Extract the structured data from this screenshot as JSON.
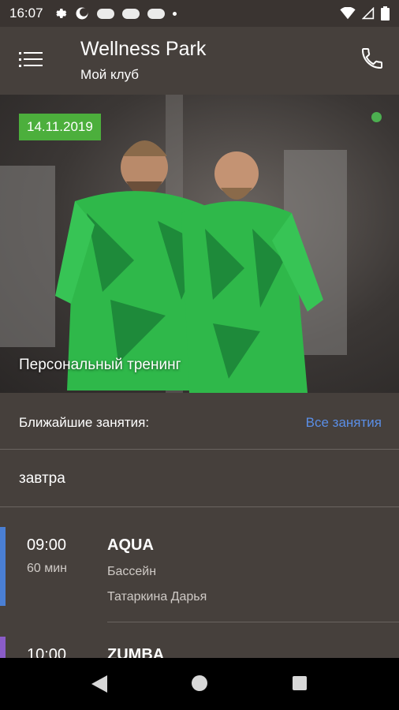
{
  "status_bar": {
    "time": "16:07"
  },
  "app_bar": {
    "title": "Wellness Park",
    "subtitle": "Мой клуб"
  },
  "hero": {
    "date": "14.11.2019",
    "caption": "Персональный тренинг"
  },
  "upcoming": {
    "label": "Ближайшие занятия:",
    "all_link": "Все занятия"
  },
  "day_label": "завтра",
  "classes": [
    {
      "time": "09:00",
      "duration": "60 мин",
      "name": "AQUA",
      "place": "Бассейн",
      "coach": "Татаркина Дарья",
      "color": "#4a7fd4"
    },
    {
      "time": "10:00",
      "duration": "",
      "name": "ZUMBA",
      "place": "",
      "coach": "",
      "color": "#8a5cc8"
    }
  ],
  "colors": {
    "background": "#46403c",
    "accent_green": "#4caf3c",
    "link_blue": "#5a8ee6"
  }
}
